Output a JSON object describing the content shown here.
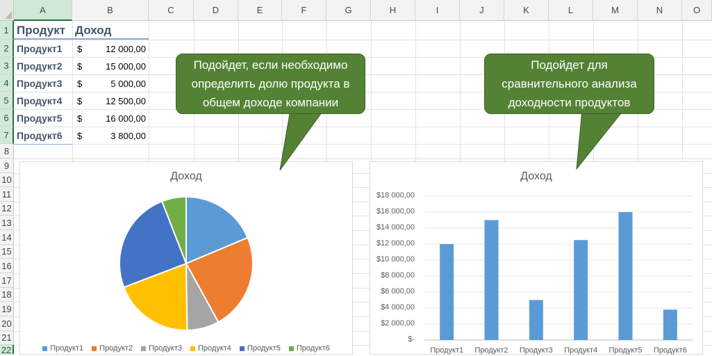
{
  "columns": [
    "A",
    "B",
    "C",
    "D",
    "E",
    "F",
    "G",
    "H",
    "I",
    "J",
    "K",
    "L",
    "M",
    "N",
    "O"
  ],
  "rows": [
    "1",
    "2",
    "3",
    "4",
    "5",
    "6",
    "7",
    "8",
    "9",
    "10",
    "11",
    "12",
    "13",
    "14",
    "15",
    "16",
    "17",
    "18",
    "19",
    "20",
    "21",
    "22"
  ],
  "table": {
    "header_product": "Продукт",
    "header_income": "Доход",
    "currency": "$",
    "items": [
      {
        "name": "Продукт1",
        "value": "12 000,00"
      },
      {
        "name": "Продукт2",
        "value": "15 000,00"
      },
      {
        "name": "Продукт3",
        "value": "5 000,00"
      },
      {
        "name": "Продукт4",
        "value": "12 500,00"
      },
      {
        "name": "Продукт5",
        "value": "16 000,00"
      },
      {
        "name": "Продукт6",
        "value": "3 800,00"
      }
    ]
  },
  "callouts": {
    "pie_lines": [
      "Подойдет, если необходимо",
      "определить долю продукта в",
      "общем доходе компании"
    ],
    "bar_lines": [
      "Подойдет для",
      "сравнительного анализа",
      "доходности продуктов"
    ]
  },
  "colors": {
    "callout_green": "#548235",
    "header_selected": "#d3e9d8",
    "bar_blue": "#5b9bd5"
  },
  "chart_data": [
    {
      "type": "pie",
      "title": "Доход",
      "categories": [
        "Продукт1",
        "Продукт2",
        "Продукт3",
        "Продукт4",
        "Продукт5",
        "Продукт6"
      ],
      "values": [
        12000,
        15000,
        5000,
        12500,
        16000,
        3800
      ],
      "colors": [
        "#5b9bd5",
        "#ed7d31",
        "#a5a5a5",
        "#ffc000",
        "#4472c4",
        "#70ad47"
      ],
      "legend": "bottom"
    },
    {
      "type": "bar",
      "title": "Доход",
      "categories": [
        "Продукт1",
        "Продукт2",
        "Продукт3",
        "Продукт4",
        "Продукт5",
        "Продукт6"
      ],
      "values": [
        12000,
        15000,
        5000,
        12500,
        16000,
        3800
      ],
      "ylim": [
        0,
        18000
      ],
      "ytick_labels": [
        "$-",
        "$2 000,00",
        "$4 000,00",
        "$6 000,00",
        "$8 000,00",
        "$10 000,00",
        "$12 000,00",
        "$14 000,00",
        "$16 000,00",
        "$18 000,00"
      ],
      "grid": true,
      "color": "#5b9bd5"
    }
  ]
}
